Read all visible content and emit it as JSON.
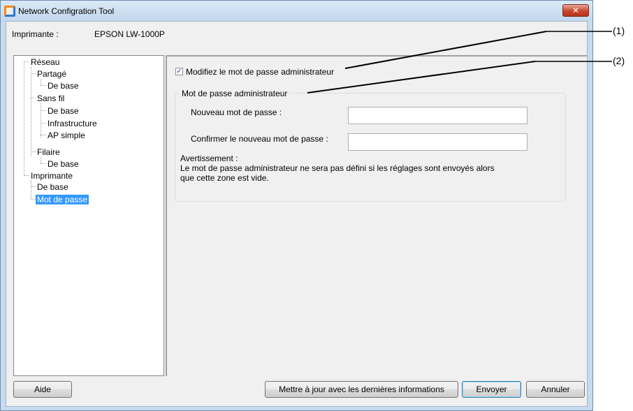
{
  "window": {
    "title": "Network Configration Tool",
    "close_glyph": "✕"
  },
  "printer": {
    "label": "Imprimante :",
    "value": "EPSON LW-1000P"
  },
  "tree": {
    "reseau": "Réseau",
    "partage": "Partagé",
    "partage_base": "De base",
    "sans_fil": "Sans fil",
    "sans_fil_base": "De base",
    "infrastructure": "Infrastructure",
    "ap_simple": "AP simple",
    "filaire": "Filaire",
    "filaire_base": "De base",
    "imprimante": "Imprimante",
    "imprimante_base": "De base",
    "mot_de_passe": "Mot de passe"
  },
  "form": {
    "checkbox_label": "Modifiez le mot de passe administrateur",
    "checkbox_checked": true,
    "group_title": "Mot de passe administrateur",
    "new_password_label": "Nouveau mot de passe :",
    "new_password_value": "",
    "confirm_password_label": "Confirmer le nouveau mot de passe :",
    "confirm_password_value": "",
    "warning_title": "Avertissement :",
    "warning_line1": "Le mot de passe administrateur ne sera pas défini si les réglages sont envoyés alors",
    "warning_line2": "que cette zone est vide."
  },
  "buttons": {
    "help": "Aide",
    "update": "Mettre à jour avec les dernières informations",
    "send": "Envoyer",
    "cancel": "Annuler"
  },
  "callouts": {
    "one": "(1)",
    "two": "(2)"
  }
}
